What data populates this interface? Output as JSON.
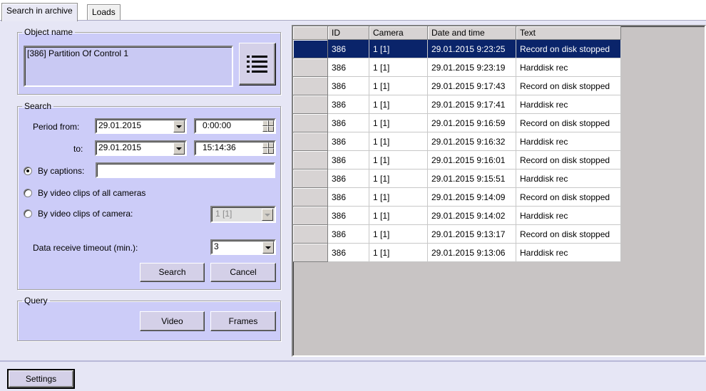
{
  "tabs": [
    {
      "label": "Search in archive",
      "active": true
    },
    {
      "label": "Loads",
      "active": false
    }
  ],
  "object_name": {
    "legend": "Object name",
    "list_items": [
      "[386] Partition  Of Control 1"
    ],
    "list_icon": "list-icon"
  },
  "search": {
    "legend": "Search",
    "period_from_label": "Period from:",
    "from_date": "29.01.2015",
    "from_time": "0:00:00",
    "to_label": "to:",
    "to_date": "29.01.2015",
    "to_time": "15:14:36",
    "by_captions_label": "By captions:",
    "by_captions_value": "",
    "by_all_cameras_label": "By video clips of all cameras",
    "by_camera_label": "By video clips of camera:",
    "camera_value": "1 [1]",
    "timeout_label": "Data receive timeout (min.):",
    "timeout_value": "3",
    "search_button": "Search",
    "cancel_button": "Cancel",
    "selected_mode": "by_captions"
  },
  "query": {
    "legend": "Query",
    "video_button": "Video",
    "frames_button": "Frames"
  },
  "results": {
    "columns": [
      "ID",
      "Camera",
      "Date and time",
      "Text"
    ],
    "selected_row": 0,
    "rows": [
      [
        "386",
        "1 [1]",
        "29.01.2015 9:23:25",
        "Record on disk stopped"
      ],
      [
        "386",
        "1 [1]",
        "29.01.2015 9:23:19",
        "Harddisk rec"
      ],
      [
        "386",
        "1 [1]",
        "29.01.2015 9:17:43",
        "Record on disk stopped"
      ],
      [
        "386",
        "1 [1]",
        "29.01.2015 9:17:41",
        "Harddisk rec"
      ],
      [
        "386",
        "1 [1]",
        "29.01.2015 9:16:59",
        "Record on disk stopped"
      ],
      [
        "386",
        "1 [1]",
        "29.01.2015 9:16:32",
        "Harddisk rec"
      ],
      [
        "386",
        "1 [1]",
        "29.01.2015 9:16:01",
        "Record on disk stopped"
      ],
      [
        "386",
        "1 [1]",
        "29.01.2015 9:15:51",
        "Harddisk rec"
      ],
      [
        "386",
        "1 [1]",
        "29.01.2015 9:14:09",
        "Record on disk stopped"
      ],
      [
        "386",
        "1 [1]",
        "29.01.2015 9:14:02",
        "Harddisk rec"
      ],
      [
        "386",
        "1 [1]",
        "29.01.2015 9:13:17",
        "Record on disk stopped"
      ],
      [
        "386",
        "1 [1]",
        "29.01.2015 9:13:06",
        "Harddisk rec"
      ]
    ]
  },
  "settings_button": "Settings",
  "colors": {
    "panel_bg": "#ccccf8",
    "selection": "#0a246a",
    "grid_bg": "#c8c4c4"
  }
}
